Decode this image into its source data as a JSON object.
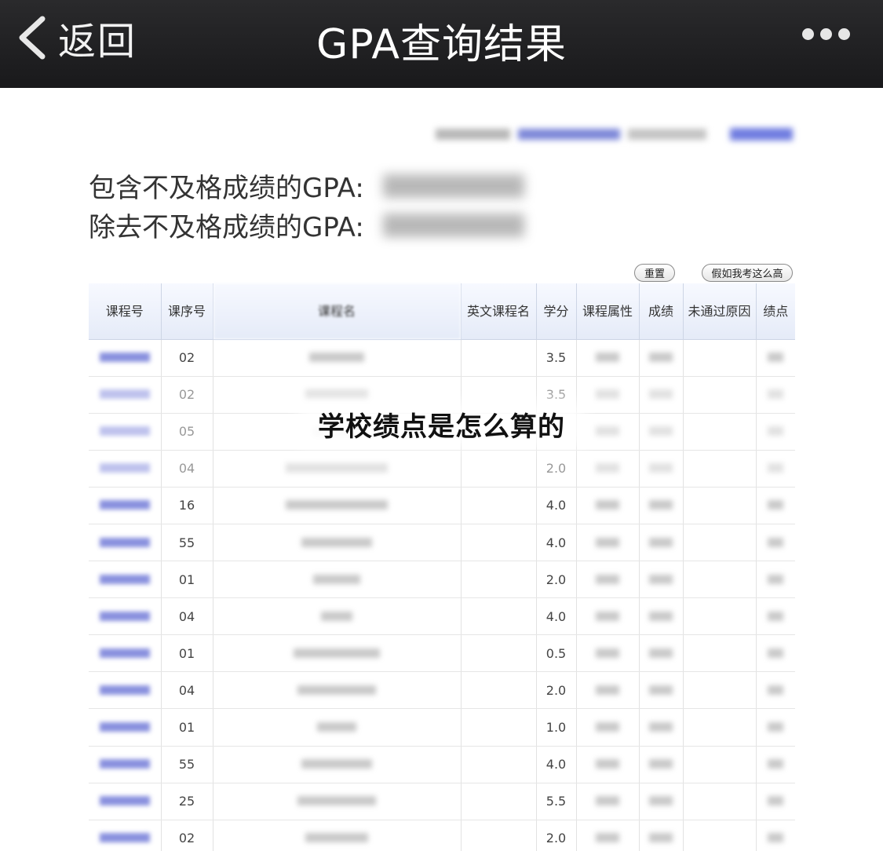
{
  "nav": {
    "back_label": "返回",
    "title": "GPA查询结果"
  },
  "summary": {
    "gpa_with_fail_label": "包含不及格成绩的GPA:",
    "gpa_without_fail_label": "除去不及格成绩的GPA:"
  },
  "buttons": {
    "reset": "重置",
    "what_if": "假如我考这么高"
  },
  "table": {
    "headers": [
      "课程号",
      "课序号",
      "课程名",
      "英文课程名",
      "学分",
      "课程属性",
      "成绩",
      "未通过原因",
      "绩点"
    ],
    "rows": [
      {
        "seq": "02",
        "credit": "3.5"
      },
      {
        "seq": "02",
        "credit": "3.5"
      },
      {
        "seq": "05",
        "credit": ""
      },
      {
        "seq": "04",
        "credit": "2.0"
      },
      {
        "seq": "16",
        "credit": "4.0"
      },
      {
        "seq": "55",
        "credit": "4.0"
      },
      {
        "seq": "01",
        "credit": "2.0"
      },
      {
        "seq": "04",
        "credit": "4.0"
      },
      {
        "seq": "01",
        "credit": "0.5"
      },
      {
        "seq": "04",
        "credit": "2.0"
      },
      {
        "seq": "01",
        "credit": "1.0"
      },
      {
        "seq": "55",
        "credit": "4.0"
      },
      {
        "seq": "25",
        "credit": "5.5"
      },
      {
        "seq": "02",
        "credit": "2.0"
      }
    ]
  },
  "overlay_caption": "学校绩点是怎么算的"
}
